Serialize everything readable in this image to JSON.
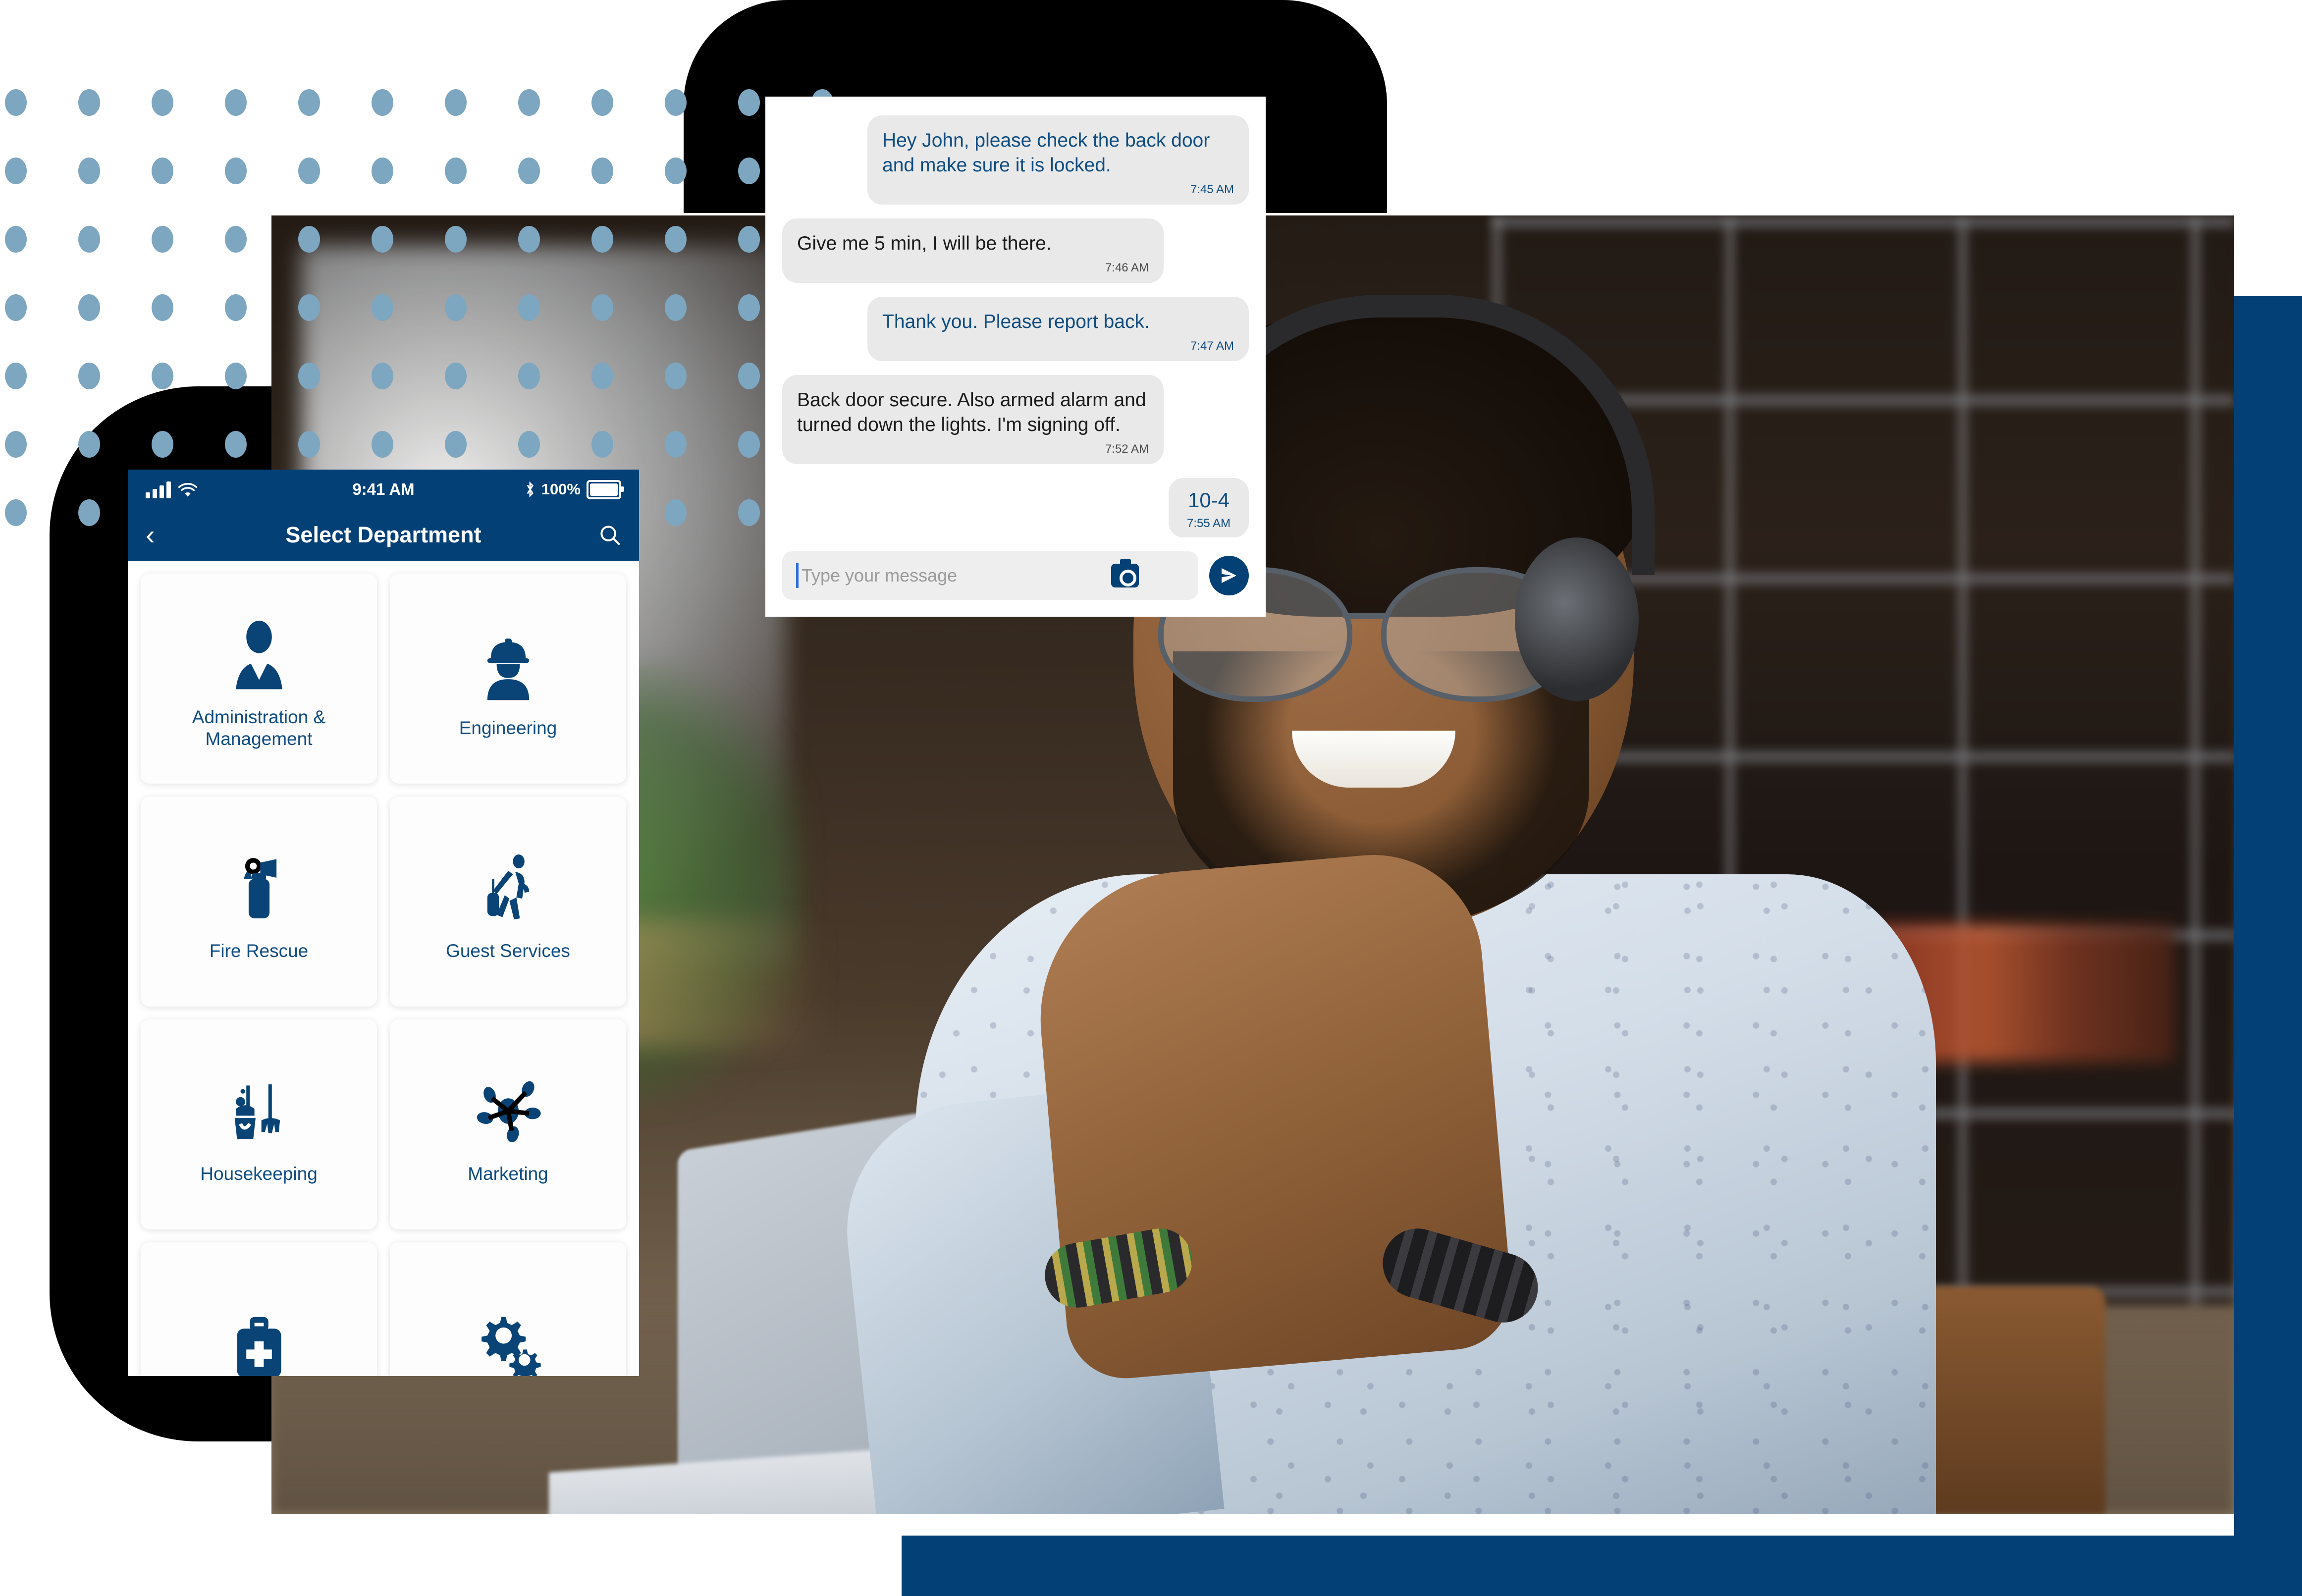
{
  "brand": {
    "accent_blue": "#034076",
    "dot_blue": "#7DA6C0",
    "text_blue": "#0f4c81"
  },
  "chat": {
    "messages": [
      {
        "side": "out",
        "text": "Hey John, please check the back door and make sure it is locked.",
        "time": "7:45 AM"
      },
      {
        "side": "in",
        "text": "Give me 5 min, I will be there.",
        "time": "7:46 AM"
      },
      {
        "side": "out",
        "text": "Thank you. Please report back.",
        "time": "7:47 AM"
      },
      {
        "side": "in",
        "text": "Back door secure. Also armed alarm and turned down the lights. I'm signing off.",
        "time": "7:52 AM"
      },
      {
        "side": "out",
        "text": "10-4",
        "time": "7:55 AM"
      }
    ],
    "composer": {
      "placeholder": "Type your message",
      "camera_icon": "camera-icon",
      "send_icon": "send-icon"
    }
  },
  "phone": {
    "status_bar": {
      "signal_icon": "cellular-signal-icon",
      "wifi_icon": "wifi-icon",
      "time": "9:41 AM",
      "bluetooth_icon": "bluetooth-icon",
      "battery_percent": "100%",
      "battery_icon": "battery-full-icon"
    },
    "nav": {
      "back_icon": "chevron-left-icon",
      "title": "Select Department",
      "search_icon": "search-icon"
    },
    "departments": [
      {
        "label": "Administration & Management",
        "icon": "business-person-icon"
      },
      {
        "label": "Engineering",
        "icon": "hard-hat-worker-icon"
      },
      {
        "label": "Fire Rescue",
        "icon": "fire-extinguisher-icon"
      },
      {
        "label": "Guest Services",
        "icon": "traveler-luggage-icon"
      },
      {
        "label": "Housekeeping",
        "icon": "mop-bucket-icon"
      },
      {
        "label": "Marketing",
        "icon": "network-hub-icon"
      },
      {
        "label": "",
        "icon": "medical-kit-icon"
      },
      {
        "label": "",
        "icon": "gears-icon"
      }
    ]
  },
  "decor": {
    "dot_rows": 7,
    "dot_cols": 12
  }
}
